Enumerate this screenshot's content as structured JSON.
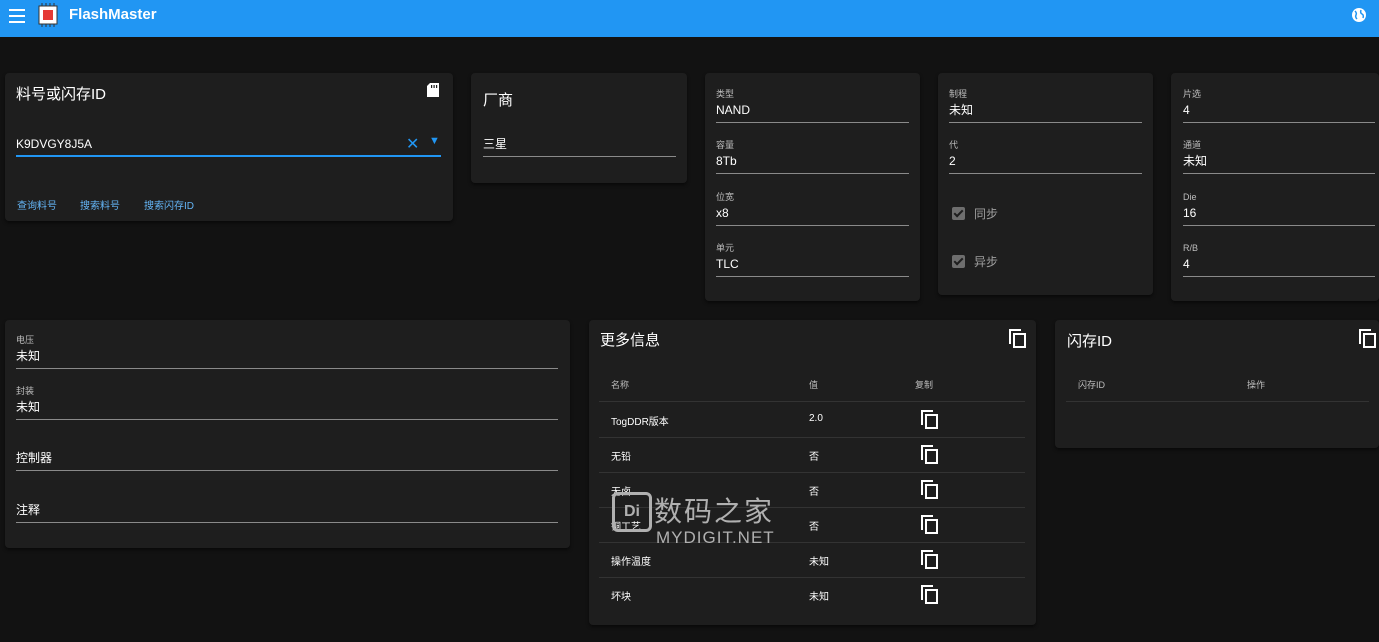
{
  "app": {
    "title": "FlashMaster"
  },
  "search_card": {
    "title": "料号或闪存ID",
    "input_value": "K9DVGY8J5A",
    "buttons": [
      "查询料号",
      "搜索料号",
      "搜索闪存ID"
    ]
  },
  "vendor_card": {
    "title": "厂商",
    "value": "三星"
  },
  "spec_col1": [
    {
      "label": "类型",
      "value": "NAND"
    },
    {
      "label": "容量",
      "value": "8Tb"
    },
    {
      "label": "位宽",
      "value": "x8"
    },
    {
      "label": "单元",
      "value": "TLC"
    }
  ],
  "spec_col2": {
    "fields": [
      {
        "label": "制程",
        "value": "未知"
      },
      {
        "label": "代",
        "value": "2"
      }
    ],
    "checkboxes": [
      {
        "label": "同步",
        "checked": true
      },
      {
        "label": "异步",
        "checked": true
      }
    ]
  },
  "spec_col3": [
    {
      "label": "片选",
      "value": "4"
    },
    {
      "label": "通道",
      "value": "未知"
    },
    {
      "label": "Die",
      "value": "16"
    },
    {
      "label": "R/B",
      "value": "4"
    }
  ],
  "misc_card": [
    {
      "label": "电压",
      "value": "未知"
    },
    {
      "label": "封装",
      "value": "未知"
    },
    {
      "label": "",
      "value": "控制器"
    },
    {
      "label": "",
      "value": "注释"
    }
  ],
  "more_info": {
    "title": "更多信息",
    "headers": [
      "名称",
      "值",
      "复制"
    ],
    "rows": [
      {
        "name": "TogDDR版本",
        "value": "2.0"
      },
      {
        "name": "无铅",
        "value": "否"
      },
      {
        "name": "无卤",
        "value": "否"
      },
      {
        "name": "铜工艺",
        "value": "否"
      },
      {
        "name": "操作温度",
        "value": "未知"
      },
      {
        "name": "坏块",
        "value": "未知"
      }
    ]
  },
  "flash_id_card": {
    "title": "闪存ID",
    "headers": [
      "闪存ID",
      "操作"
    ]
  },
  "watermark": {
    "cn": "数码之家",
    "en": "MYDIGIT.NET",
    "logo": "Di"
  },
  "colors": {
    "appbar": "#2196f3",
    "background": "#121212",
    "card": "#1e1e1e",
    "accent": "#64b5f6"
  },
  "icons": {
    "menu": "menu-icon",
    "logo": "chip-logo-icon",
    "globe": "globe-icon",
    "save": "sd-card-icon",
    "clear": "close-icon",
    "dropdown": "caret-down-icon",
    "copy": "copy-icon"
  }
}
